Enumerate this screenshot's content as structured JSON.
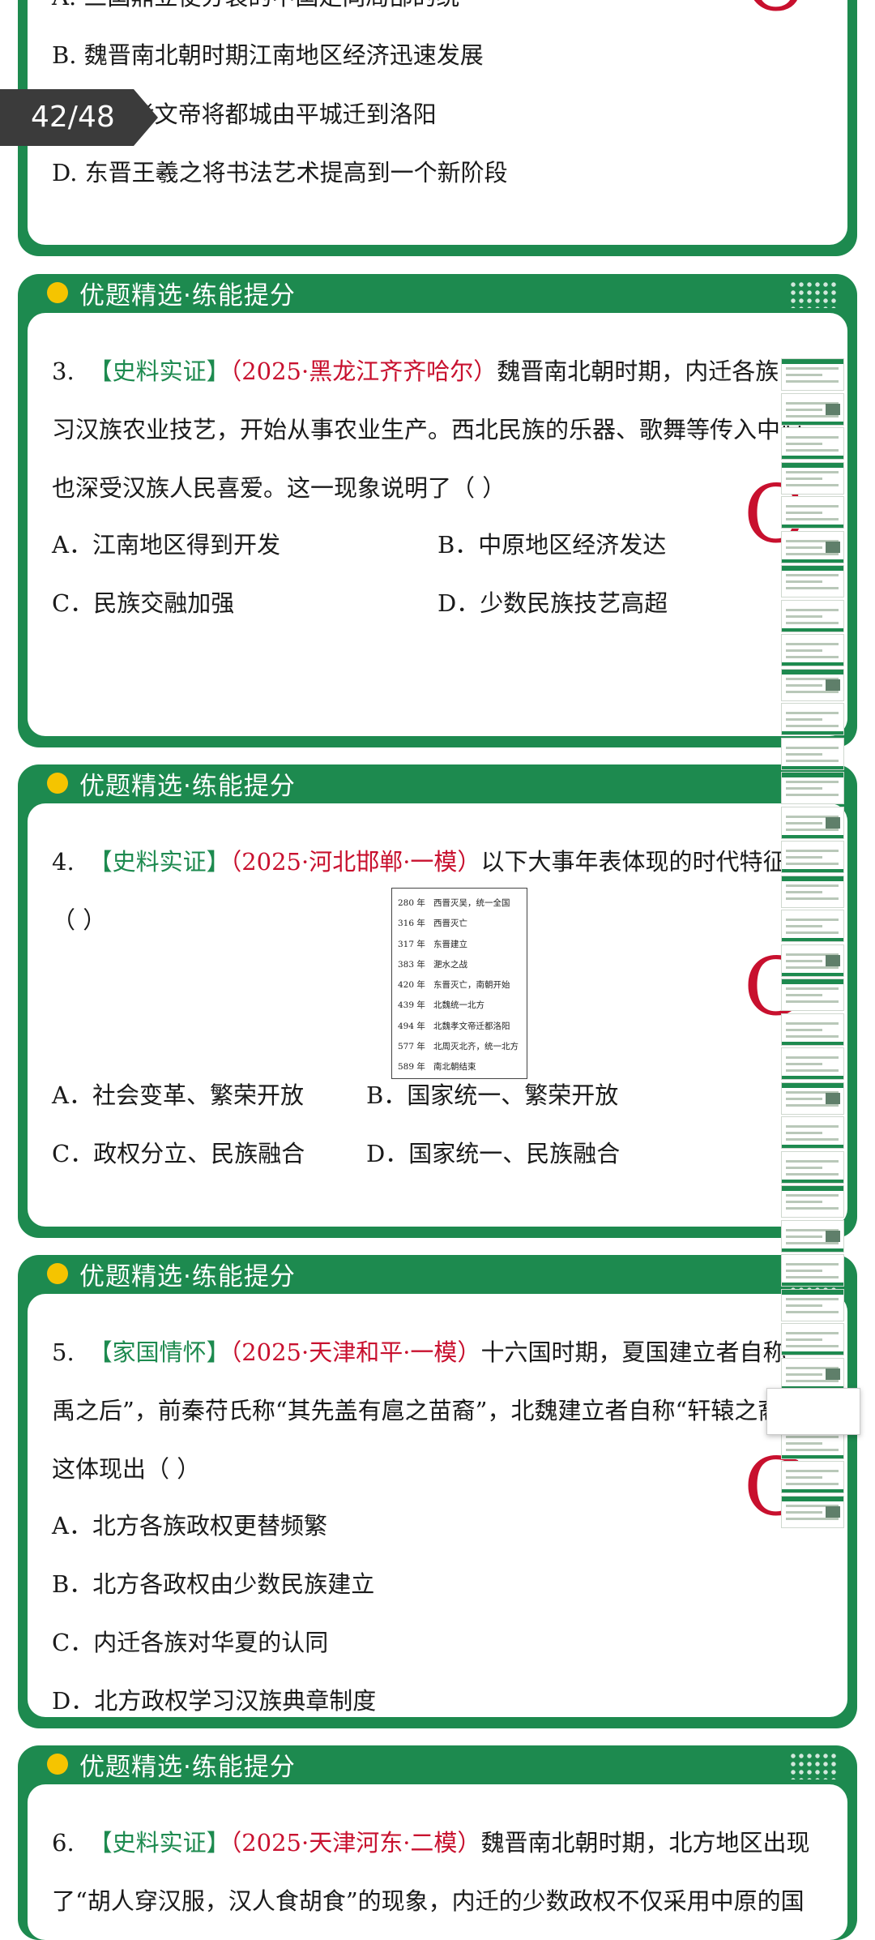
{
  "top_card": {
    "option_a": "A. 三国鼎立使分裂的中国走向局部的统一",
    "option_b": "B. 魏晋南北朝时期江南地区经济迅速发展",
    "option_c": "C. 北魏孝文帝将都城由平城迁到洛阳",
    "option_d": "D. 东晋王羲之将书法艺术提高到一个新阶段",
    "answer": "C"
  },
  "page_counter": "42/48",
  "section_title": "优题精选·练能提分",
  "questions": [
    {
      "num": "3.",
      "tag": "【史料实证】",
      "source": "（2025·黑龙江齐齐哈尔）",
      "line1": "魏晋南北朝时期，内迁各族",
      "line2": "习汉族农业技艺，开始从事农业生产。西北民族的乐器、歌舞等传入中原，",
      "line3": "也深受汉族人民喜爱。这一现象说明了（   ）",
      "option_a": "A．江南地区得到开发",
      "option_b": "B．中原地区经济发达",
      "option_c": "C．民族交融加强",
      "option_d": "D．少数民族技艺高超",
      "answer": "C"
    },
    {
      "num": "4.",
      "tag": "【史料实证】",
      "source": "（2025·河北邯郸·一模）",
      "line1": "以下大事年表体现的时代特征",
      "line2": "（   ）",
      "timeline": [
        {
          "year": "280 年",
          "event": "西晋灭吴，统一全国"
        },
        {
          "year": "316 年",
          "event": "西晋灭亡"
        },
        {
          "year": "317 年",
          "event": "东晋建立"
        },
        {
          "year": "383 年",
          "event": "淝水之战"
        },
        {
          "year": "420 年",
          "event": "东晋灭亡，南朝开始"
        },
        {
          "year": "439 年",
          "event": "北魏统一北方"
        },
        {
          "year": "494 年",
          "event": "北魏孝文帝迁都洛阳"
        },
        {
          "year": "577 年",
          "event": "北周灭北齐，统一北方"
        },
        {
          "year": "589 年",
          "event": "南北朝结束"
        }
      ],
      "option_a": "A．社会变革、繁荣开放",
      "option_b": "B．国家统一、繁荣开放",
      "option_c": "C．政权分立、民族融合",
      "option_d": "D．国家统一、民族融合",
      "answer": "C"
    },
    {
      "num": "5.",
      "tag": "【家国情怀】",
      "source": "（2025·天津和平·一模）",
      "line1": "十六国时期，夏国建立者自称",
      "line2": "禹之后”，前秦苻氏称“其先盖有扈之苗裔”，北魏建立者自称“轩辕之裔”。",
      "line3": "这体现出（     ）",
      "option_a": "A．北方各族政权更替频繁",
      "option_b": "B．北方各政权由少数民族建立",
      "option_c": "C．内迁各族对华夏的认同",
      "option_d": "D．北方政权学习汉族典章制度",
      "answer": "C"
    },
    {
      "num": "6.",
      "tag": "【史料实证】",
      "source": "（2025·天津河东·二模）",
      "line1": "魏晋南北朝时期，北方地区出现",
      "line2": "了“胡人穿汉服，汉人食胡食”的现象，内迁的少数政权不仅采用中原的国"
    }
  ]
}
